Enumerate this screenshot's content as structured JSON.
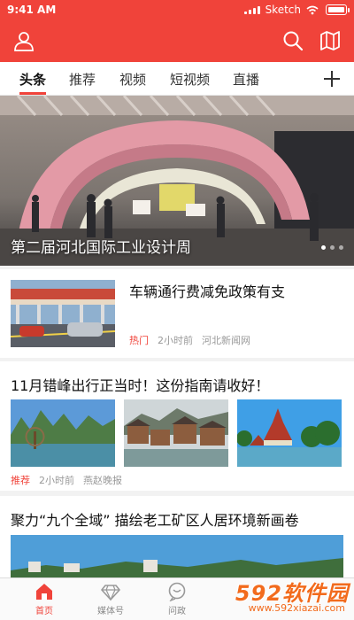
{
  "status": {
    "time": "9:41 AM",
    "carrier": "Sketch",
    "battery_level": 1.0
  },
  "tabs": [
    {
      "label": "头条",
      "active": true
    },
    {
      "label": "推荐"
    },
    {
      "label": "视频"
    },
    {
      "label": "短视频"
    },
    {
      "label": "直播"
    }
  ],
  "hero": {
    "title": "第二届河北国际工业设计周",
    "slides": 3,
    "current": 1
  },
  "news": [
    {
      "title": "车辆通行费减免政策有支",
      "tag": "热门",
      "time": "2小时前",
      "source": "河北新闻网"
    },
    {
      "title": "11月错峰出行正当时！这份指南请收好！",
      "tag": "推荐",
      "time": "2小时前",
      "source": "燕赵晚报"
    },
    {
      "title": "聚力“九个全域” 描绘老工矿区人居环境新画卷"
    }
  ],
  "bottom_nav": [
    {
      "label": "首页",
      "icon": "home-icon",
      "active": true
    },
    {
      "label": "媒体号",
      "icon": "diamond-icon"
    },
    {
      "label": "问政",
      "icon": "chat-icon"
    }
  ],
  "watermark": {
    "brand": "592软件园",
    "url": "www.592xiazai.com"
  },
  "colors": {
    "accent": "#f0433a",
    "watermark": "#f26b1d"
  }
}
